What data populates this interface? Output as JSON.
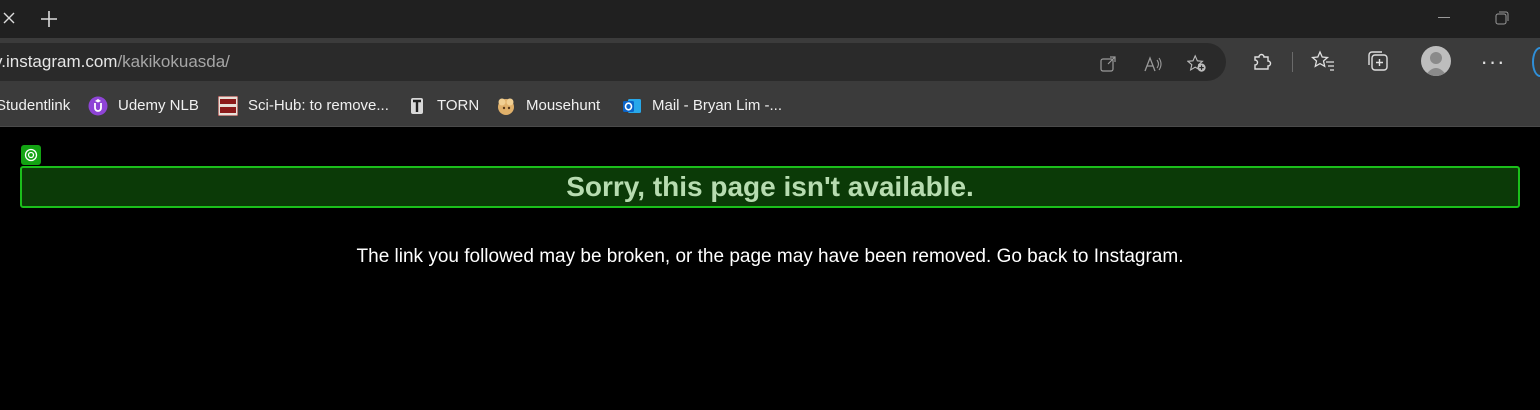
{
  "browser": {
    "url_host": "v.instagram.com",
    "url_path": "/kakikokuasda/",
    "icons": {
      "tab_close": "close-icon",
      "new_tab": "plus-icon",
      "minimize": "minimize-icon",
      "restore": "restore-icon",
      "open_in_app": "open-in-app-icon",
      "read_aloud": "read-aloud-icon",
      "add_favorite": "add-favorite-icon",
      "extensions": "puzzle-icon",
      "favorites": "favorites-list-icon",
      "collections": "collections-icon",
      "profile": "profile-avatar",
      "more": "more-icon"
    }
  },
  "bookmarks": [
    {
      "label": "Studentlink",
      "icon": "none"
    },
    {
      "label": "Udemy NLB",
      "icon": "udemy-icon"
    },
    {
      "label": "Sci-Hub: to remove...",
      "icon": "scihub-icon"
    },
    {
      "label": "TORN",
      "icon": "torn-icon"
    },
    {
      "label": "Mousehunt",
      "icon": "mousehunt-icon"
    },
    {
      "label": "Mail - Bryan Lim -...",
      "icon": "outlook-icon"
    }
  ],
  "page": {
    "heading": "Sorry, this page isn't available.",
    "message": "The link you followed may be broken, or the page may have been removed.",
    "back_link": "Go back to Instagram."
  },
  "colors": {
    "highlight_border": "#1bbf1b",
    "highlight_fill": "#0b3a07",
    "heading_text": "#b7dcb0"
  }
}
